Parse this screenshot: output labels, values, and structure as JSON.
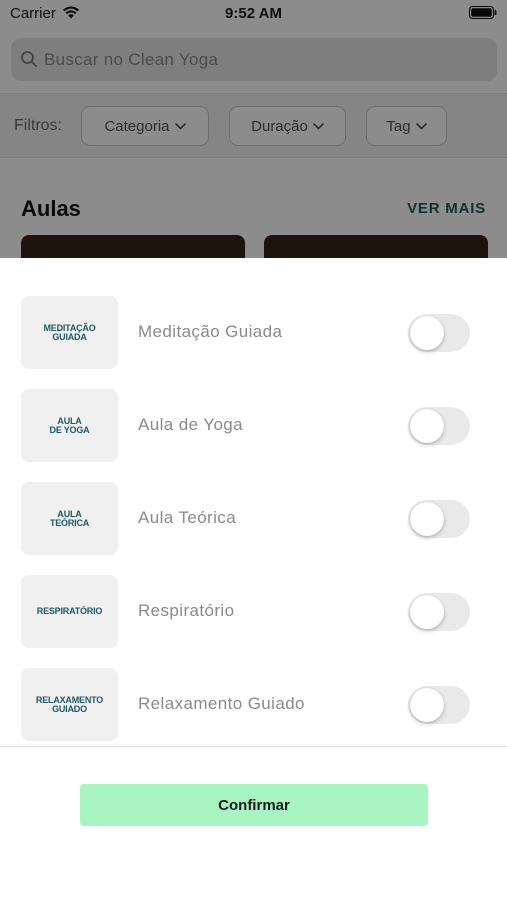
{
  "status_bar": {
    "carrier": "Carrier",
    "time": "9:52 AM"
  },
  "search": {
    "placeholder": "Buscar no Clean Yoga"
  },
  "filters": {
    "label": "Filtros:",
    "chips": [
      {
        "label": "Categoria"
      },
      {
        "label": "Duração"
      },
      {
        "label": "Tag"
      }
    ]
  },
  "section": {
    "title": "Aulas",
    "see_more": "VER MAIS"
  },
  "sheet": {
    "options": [
      {
        "label": "Meditação Guiada",
        "icon": "meditacao-guiada-logo",
        "logo_lines": [
          "MEDITAÇÃO",
          "GUIADA"
        ],
        "enabled": false
      },
      {
        "label": "Aula de Yoga",
        "icon": "aula-de-yoga-logo",
        "logo_lines": [
          "AULA",
          "DE YOGA"
        ],
        "enabled": false
      },
      {
        "label": "Aula Teórica",
        "icon": "aula-teorica-logo",
        "logo_lines": [
          "AULA",
          "TEÓRICA"
        ],
        "enabled": false
      },
      {
        "label": "Respiratório",
        "icon": "respiratorio-logo",
        "logo_lines": [
          "RESPIRATÓRIO"
        ],
        "enabled": false
      },
      {
        "label": "Relaxamento Guiado",
        "icon": "relaxamento-guiado-logo",
        "logo_lines": [
          "RELAXAMENTO",
          "GUIADO"
        ],
        "enabled": false
      }
    ],
    "confirm_label": "Confirmar"
  },
  "colors": {
    "accent_green": "#a8f5c1",
    "brand_teal": "#1e5a54",
    "toggle_off": "#e9e9ea"
  }
}
